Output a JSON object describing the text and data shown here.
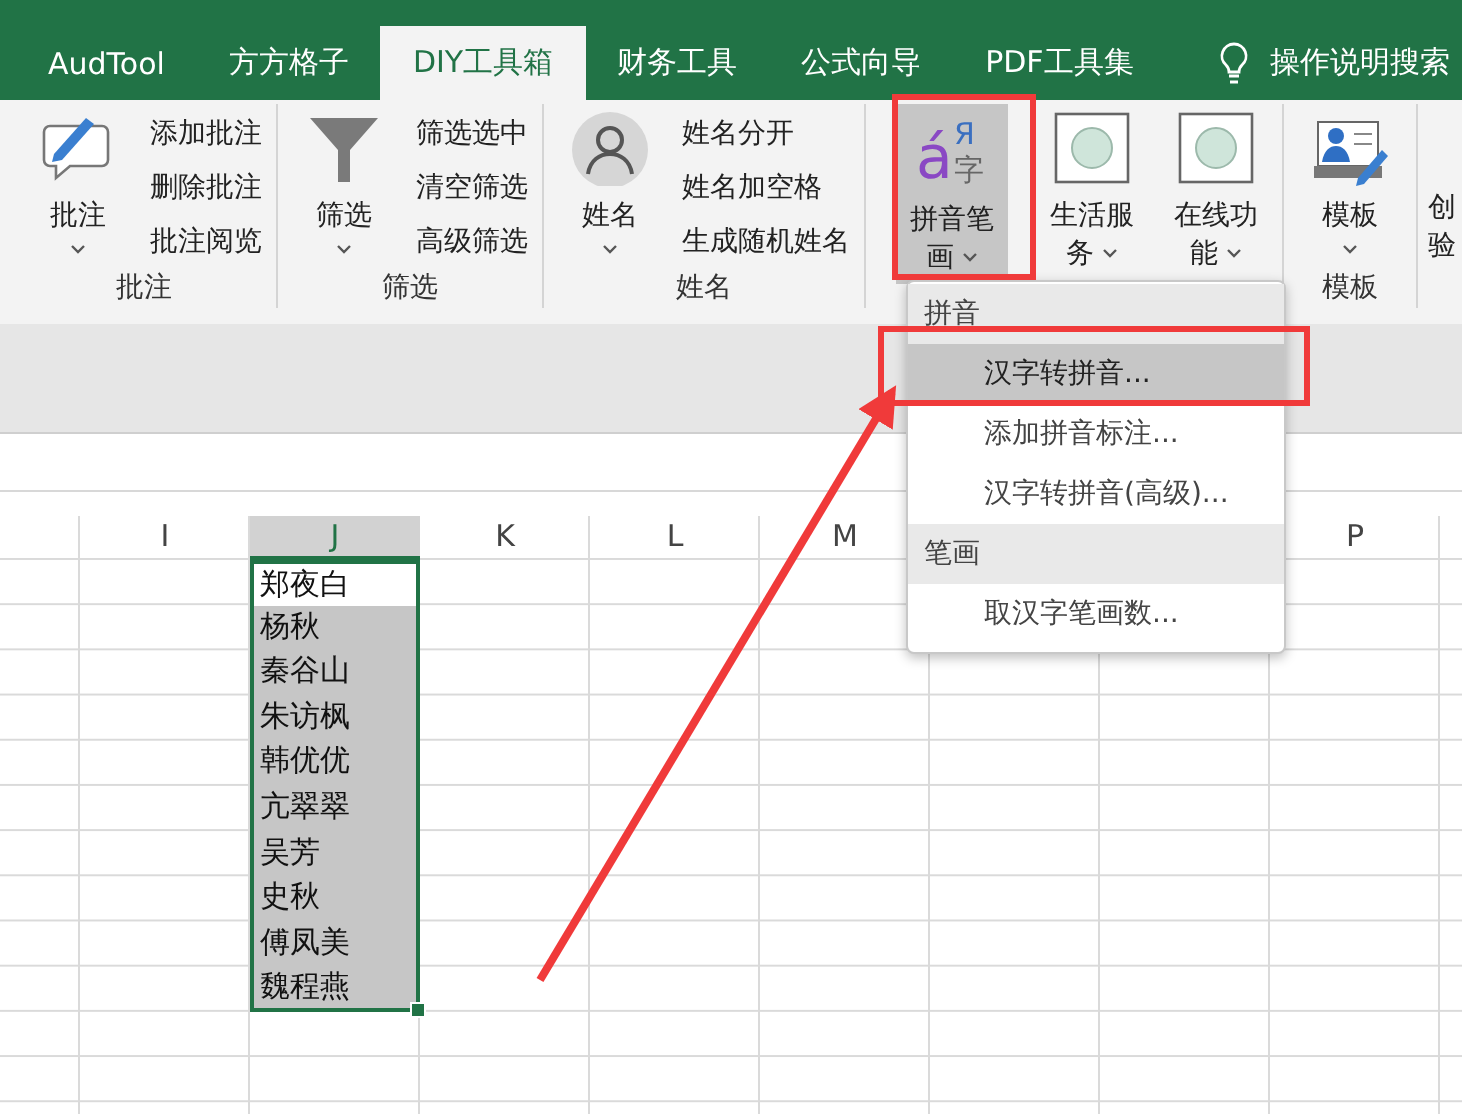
{
  "ribbon_tabs": [
    {
      "label": "AudTool",
      "selected": false
    },
    {
      "label": "方方格子",
      "selected": false
    },
    {
      "label": "DIY工具箱",
      "selected": true
    },
    {
      "label": "财务工具",
      "selected": false
    },
    {
      "label": "公式向导",
      "selected": false
    },
    {
      "label": "PDF工具集",
      "selected": false
    }
  ],
  "tell_me": {
    "label": "操作说明搜索"
  },
  "ribbon_groups": [
    {
      "label": "批注",
      "buttons": [
        {
          "kind": "large",
          "label": "批注",
          "dropdown": true,
          "pressed": false
        },
        {
          "kind": "small",
          "label": "添加批注"
        },
        {
          "kind": "small",
          "label": "删除批注"
        },
        {
          "kind": "small",
          "label": "批注阅览"
        }
      ]
    },
    {
      "label": "筛选",
      "buttons": [
        {
          "kind": "large",
          "label": "筛选",
          "dropdown": true,
          "pressed": false
        },
        {
          "kind": "small",
          "label": "筛选选中"
        },
        {
          "kind": "small",
          "label": "清空筛选"
        },
        {
          "kind": "small",
          "label": "高级筛选"
        }
      ]
    },
    {
      "label": "姓名",
      "buttons": [
        {
          "kind": "large",
          "label": "姓名",
          "dropdown": true,
          "pressed": false
        },
        {
          "kind": "small",
          "label": "姓名分开"
        },
        {
          "kind": "small",
          "label": "姓名加空格"
        },
        {
          "kind": "small",
          "label": "生成随机姓名"
        }
      ]
    },
    {
      "buttons": [
        {
          "kind": "large",
          "label": "拼音笔画",
          "dropdown": true,
          "pressed": true,
          "icon_glyphs": [
            "á",
            "Я",
            "字"
          ]
        },
        {
          "kind": "large",
          "label": "生活服务",
          "dropdown": true,
          "pressed": false
        },
        {
          "kind": "large",
          "label": "在线功能",
          "dropdown": true,
          "pressed": false
        }
      ]
    },
    {
      "label": "模板",
      "buttons": [
        {
          "kind": "large",
          "label": "模板",
          "dropdown": true,
          "pressed": false
        }
      ]
    },
    {
      "buttons": [
        {
          "kind": "large",
          "label": "创验"
        }
      ]
    }
  ],
  "dropdown_menu": {
    "sections": [
      {
        "heading": "拼音",
        "items": [
          {
            "label": "汉字转拼音...",
            "selected": true
          },
          {
            "label": "添加拼音标注...",
            "selected": false
          },
          {
            "label": "汉字转拼音(高级)...",
            "selected": false
          }
        ]
      },
      {
        "heading": "笔画",
        "items": [
          {
            "label": "取汉字笔画数...",
            "selected": false
          }
        ]
      }
    ]
  },
  "sheet": {
    "columns": [
      {
        "label": "I",
        "selected": false
      },
      {
        "label": "J",
        "selected": true
      },
      {
        "label": "K",
        "selected": false
      },
      {
        "label": "L",
        "selected": false
      },
      {
        "label": "M",
        "selected": false
      },
      {
        "label": "P",
        "selected": false
      }
    ],
    "column_J_cells": [
      {
        "value": "郑夜白",
        "active": true
      },
      {
        "value": "杨秋",
        "active": false
      },
      {
        "value": "秦谷山",
        "active": false
      },
      {
        "value": "朱访枫",
        "active": false
      },
      {
        "value": "韩优优",
        "active": false
      },
      {
        "value": "亢翠翠",
        "active": false
      },
      {
        "value": "吴芳",
        "active": false
      },
      {
        "value": "史秋",
        "active": false
      },
      {
        "value": "傅凤美",
        "active": false
      },
      {
        "value": "魏程燕",
        "active": false
      }
    ]
  }
}
